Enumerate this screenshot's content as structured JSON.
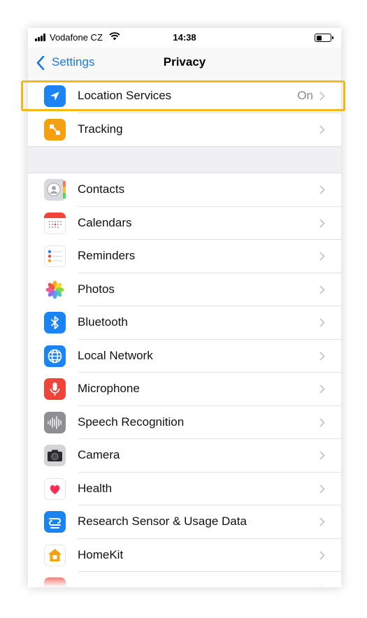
{
  "status_bar": {
    "carrier": "Vodafone CZ",
    "time": "14:38"
  },
  "nav": {
    "back_label": "Settings",
    "title": "Privacy"
  },
  "top_items": [
    {
      "label": "Location Services",
      "value": "On",
      "icon": "location-arrow-icon",
      "color": "#1a84f5"
    },
    {
      "label": "Tracking",
      "icon": "tracking-icon",
      "color": "#f5a00f"
    }
  ],
  "items": [
    {
      "label": "Contacts",
      "icon": "contacts-icon"
    },
    {
      "label": "Calendars",
      "icon": "calendar-icon"
    },
    {
      "label": "Reminders",
      "icon": "reminders-icon"
    },
    {
      "label": "Photos",
      "icon": "photos-icon"
    },
    {
      "label": "Bluetooth",
      "icon": "bluetooth-icon",
      "color": "#1a84f5"
    },
    {
      "label": "Local Network",
      "icon": "globe-icon",
      "color": "#1a84f5"
    },
    {
      "label": "Microphone",
      "icon": "microphone-icon",
      "color": "#f0443a"
    },
    {
      "label": "Speech Recognition",
      "icon": "waveform-icon",
      "color": "#8e8e93"
    },
    {
      "label": "Camera",
      "icon": "camera-icon",
      "color": "#8e8e93"
    },
    {
      "label": "Health",
      "icon": "heart-icon",
      "color": "#ff2d55"
    },
    {
      "label": "Research Sensor & Usage Data",
      "icon": "research-icon",
      "color": "#1a84f5"
    },
    {
      "label": "HomeKit",
      "icon": "home-icon",
      "color": "#f5a00f"
    }
  ],
  "highlight_color": "#f5b81c"
}
